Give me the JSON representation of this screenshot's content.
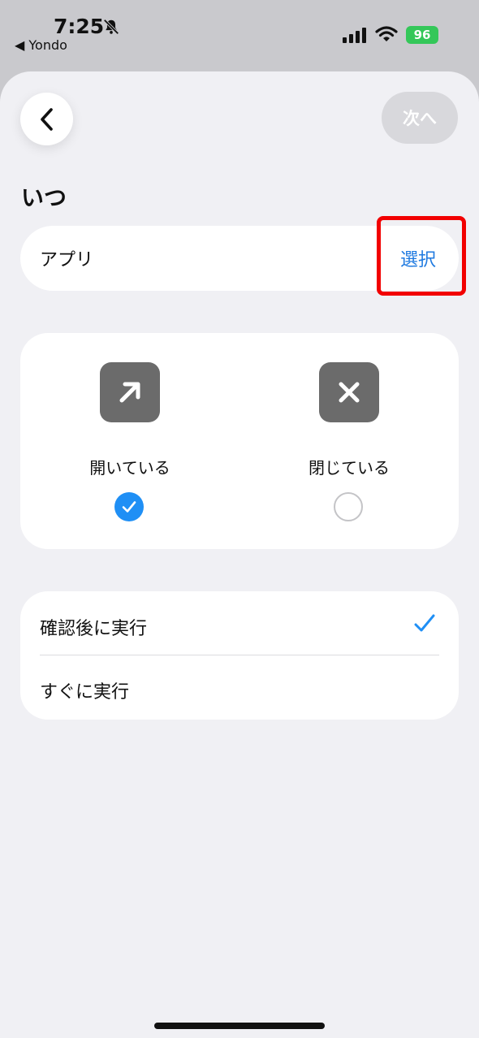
{
  "status_bar": {
    "time": "7:25",
    "back_app": "◀ Yondo",
    "battery": "96",
    "icons": [
      "bell-slash-icon",
      "cellular-signal-icon",
      "wifi-icon",
      "battery-charging-icon"
    ]
  },
  "nav": {
    "back_icon": "chevron-left-icon",
    "next_label": "次へ"
  },
  "section": {
    "title": "いつ"
  },
  "app_row": {
    "label": "アプリ",
    "select_label": "選択"
  },
  "states": [
    {
      "label": "開いている",
      "icon": "arrow-up-right-icon",
      "selected": true
    },
    {
      "label": "閉じている",
      "icon": "xmark-icon",
      "selected": false
    }
  ],
  "run_options": [
    {
      "label": "確認後に実行",
      "selected": true
    },
    {
      "label": "すぐに実行",
      "selected": false
    }
  ],
  "colors": {
    "accent": "#1f8ff5",
    "link": "#1f7ae0",
    "highlight": "#f20000",
    "battery": "#34c759"
  }
}
